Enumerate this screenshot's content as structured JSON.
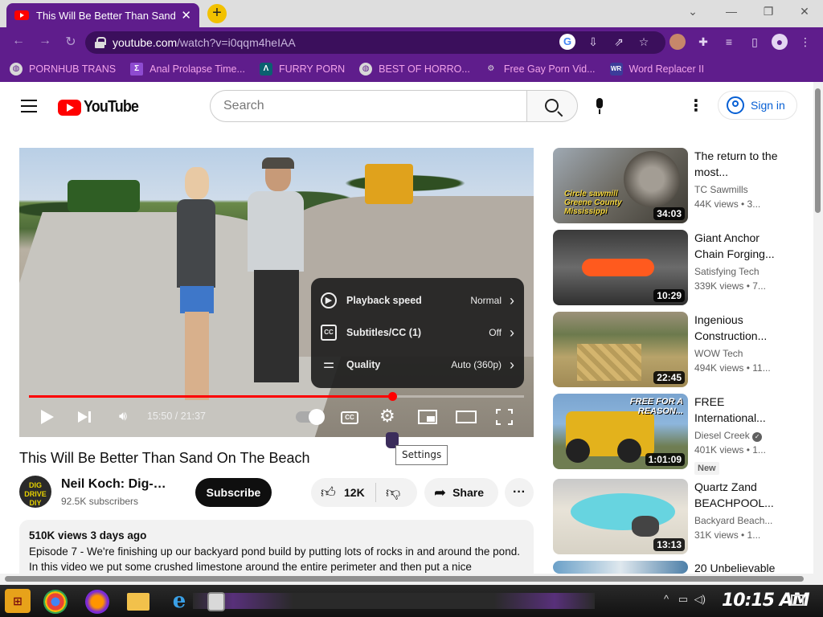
{
  "browser": {
    "tab_title": "This Will Be Better Than Sand",
    "url_host": "youtube.com",
    "url_path": "/watch?v=i0qqm4heIAA",
    "bookmarks": [
      {
        "label": "PORNHUB TRANS",
        "icon": "globe-icon"
      },
      {
        "label": "Anal Prolapse Time...",
        "icon": "bracket-icon"
      },
      {
        "label": "FURRY PORN",
        "icon": "lambda-icon"
      },
      {
        "label": "BEST OF HORRO...",
        "icon": "globe-icon"
      },
      {
        "label": "Free Gay Porn Vid...",
        "icon": "gear-icon"
      },
      {
        "label": "Word Replacer II",
        "icon": "wr-icon"
      }
    ]
  },
  "header": {
    "logo_text": "YouTube",
    "search_placeholder": "Search",
    "signin_label": "Sign in"
  },
  "player": {
    "time": "15:50 / 21:37",
    "progress_fraction": 0.733,
    "settings_menu": [
      {
        "label": "Playback speed",
        "value": "Normal",
        "icon": "play-circle-icon"
      },
      {
        "label": "Subtitles/CC (1)",
        "value": "Off",
        "icon": "cc-icon"
      },
      {
        "label": "Quality",
        "value": "Auto (360p)",
        "icon": "sliders-icon"
      }
    ],
    "cc_label": "CC",
    "tooltip": "Settings"
  },
  "video": {
    "title": "This Will Be Better Than Sand On The Beach",
    "channel_name": "Neil Koch: Dig-Dri...",
    "channel_avatar_text": "DIG DRIVE DIY",
    "subscribers": "92.5K subscribers",
    "subscribe_label": "Subscribe",
    "likes": "12K",
    "share_label": "Share",
    "views_date": "510K views  3 days ago",
    "description": "Episode 7 - We're finishing up our backyard pond build by putting lots of rocks in and around the pond.  In this video we put some crushed limestone around the entire perimeter and then put a nice"
  },
  "recommendations": [
    {
      "title": "The return to the most...",
      "channel": "TC Sawmills",
      "views": "44K views • 3...",
      "duration": "34:03",
      "thumb_text": "Circle sawmill Greene County Mississippi",
      "badge": ""
    },
    {
      "title": "Giant Anchor Chain Forging...",
      "channel": "Satisfying Tech",
      "views": "339K views • 7...",
      "duration": "10:29",
      "thumb_text": "",
      "badge": ""
    },
    {
      "title": "Ingenious Construction...",
      "channel": "WOW Tech",
      "views": "494K views • 11...",
      "duration": "22:45",
      "thumb_text": "",
      "badge": ""
    },
    {
      "title": "FREE International...",
      "channel": "Diesel Creek",
      "views": "401K views • 1...",
      "duration": "1:01:09",
      "thumb_text": "FREE FOR A REASON...",
      "badge": "New"
    },
    {
      "title": "Quartz Zand BEACHPOOL...",
      "channel": "Backyard Beach...",
      "views": "31K views • 1...",
      "duration": "13:13",
      "thumb_text": "",
      "badge": ""
    },
    {
      "title": "20 Unbelievable",
      "channel": "",
      "views": "",
      "duration": "",
      "thumb_text": "",
      "badge": ""
    }
  ],
  "taskbar": {
    "clock": "10:15 AM"
  }
}
